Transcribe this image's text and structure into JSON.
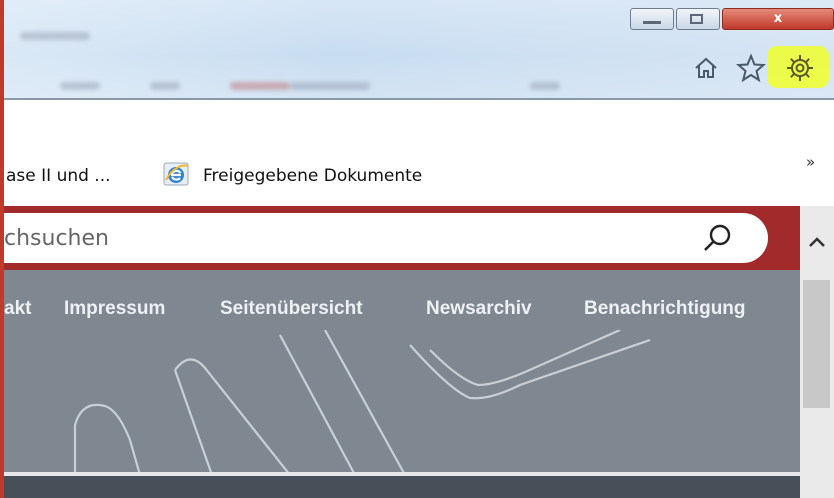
{
  "window": {
    "close_label": "x"
  },
  "toolbar": {
    "icons": [
      "home-icon",
      "star-icon",
      "gear-icon"
    ],
    "highlight_color": "#f0ff2a"
  },
  "favorites": {
    "items": [
      {
        "label": "ase II und ..."
      },
      {
        "label": "Freigegebene Dokumente",
        "icon": "ie-icon"
      }
    ],
    "overflow_label": "»"
  },
  "page": {
    "search": {
      "placeholder": "chsuchen"
    },
    "nav": [
      "akt",
      "Impressum",
      "Seitenübersicht",
      "Newsarchiv",
      "Benachrichtigung"
    ],
    "brand_color": "#a32a2a"
  }
}
